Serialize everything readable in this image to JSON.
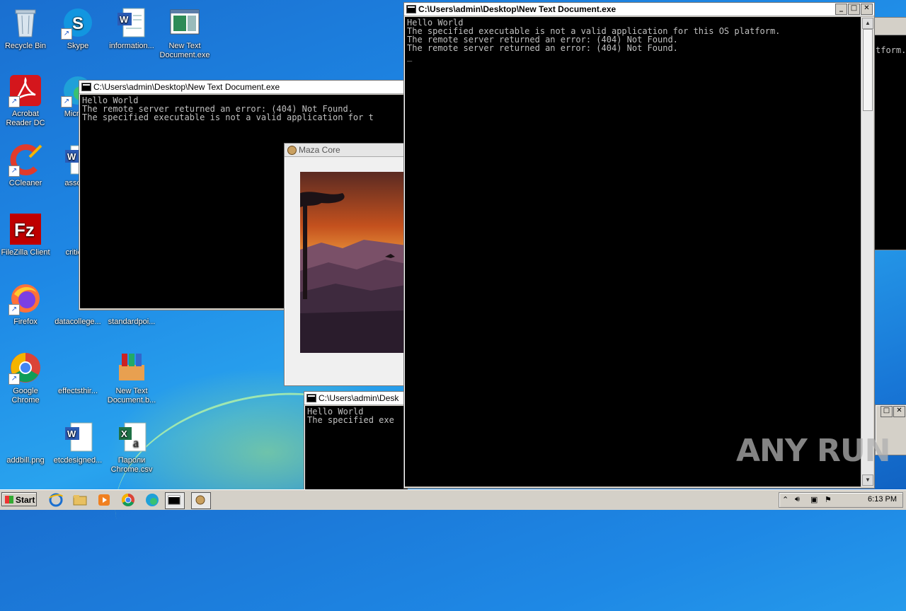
{
  "desktop": {
    "icons": [
      {
        "label": "Recycle Bin"
      },
      {
        "label": "Skype"
      },
      {
        "label": "information..."
      },
      {
        "label": "New Text Document.exe"
      },
      {
        "label": "Acrobat Reader DC"
      },
      {
        "label": "Microso"
      },
      {
        "label": "CCleaner"
      },
      {
        "label": "associa"
      },
      {
        "label": "FileZilla Client"
      },
      {
        "label": "criticalr"
      },
      {
        "label": "Firefox"
      },
      {
        "label": "datacollege..."
      },
      {
        "label": "standardpoi..."
      },
      {
        "label": "Google Chrome"
      },
      {
        "label": "effectsthir..."
      },
      {
        "label": "New Text Document.b..."
      },
      {
        "label": "addbill.png"
      },
      {
        "label": "etcdesigned..."
      },
      {
        "label": "Пароли Chrome.csv"
      }
    ]
  },
  "windows": {
    "main_console": {
      "title": "C:\\Users\\admin\\Desktop\\New Text Document.exe",
      "lines": "Hello World\nThe specified executable is not a valid application for this OS platform.\nThe remote server returned an error: (404) Not Found.\nThe remote server returned an error: (404) Not Found.\n_"
    },
    "console_two": {
      "title": "C:\\Users\\admin\\Desktop\\New Text Document.exe",
      "lines": "Hello World\nThe remote server returned an error: (404) Not Found.\nThe specified executable is not a valid application for t"
    },
    "console_three": {
      "title": "C:\\Users\\admin\\Desk",
      "lines": "Hello World\nThe specified exe"
    },
    "right_partial": {
      "text": "tform."
    },
    "maza": {
      "title": "Maza Core"
    }
  },
  "taskbar": {
    "start_label": "Start",
    "clock": "6:13 PM"
  },
  "watermark": "ANY RUN",
  "icon_names": [
    "recycle-bin-icon",
    "skype-icon",
    "word-doc-icon",
    "exe-icon",
    "acrobat-icon",
    "edge-icon",
    "ccleaner-icon",
    "filezilla-icon",
    "firefox-icon",
    "chrome-icon",
    "winrar-icon",
    "excel-icon"
  ]
}
